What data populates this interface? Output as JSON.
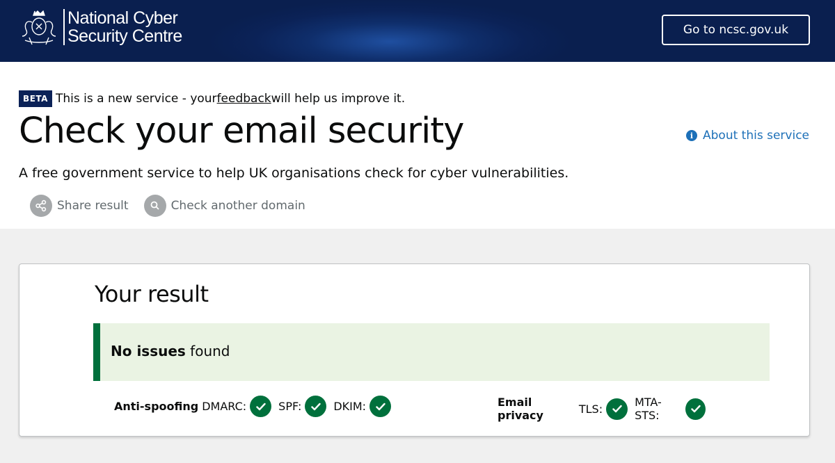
{
  "header": {
    "brand_line1": "National Cyber",
    "brand_line2": "Security Centre",
    "button_label": "Go to ncsc.gov.uk"
  },
  "beta_banner": {
    "tag": "BETA",
    "text_before": "This is a new service - your ",
    "link": "feedback",
    "text_after": " will help us improve it."
  },
  "page": {
    "title": "Check your email security",
    "about_link": "About this service",
    "subtitle": "A free government service to help UK organisations check for cyber vulnerabilities."
  },
  "actions": {
    "share": "Share result",
    "check_another": "Check another domain"
  },
  "result": {
    "heading": "Your result",
    "summary_bold": "No issues",
    "summary_rest": " found",
    "groups": [
      {
        "title": "Anti-spoofing",
        "checks": [
          "DMARC:",
          "SPF:",
          "DKIM:"
        ]
      },
      {
        "title": "Email privacy",
        "checks": [
          "TLS:",
          "MTA-STS:"
        ]
      }
    ]
  },
  "colors": {
    "header_bg": "#0b2257",
    "link_blue": "#1d70b8",
    "success_green": "#00703c",
    "success_bg": "#eaf3e3"
  }
}
